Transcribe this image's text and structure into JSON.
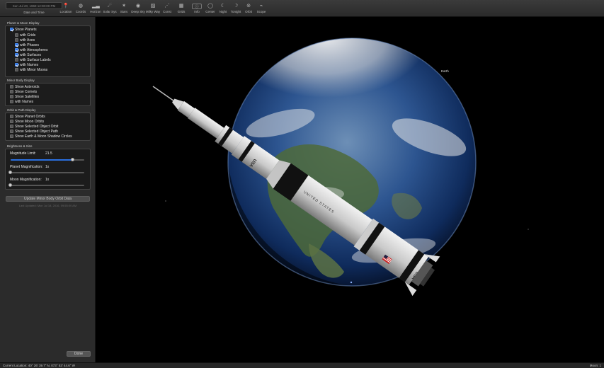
{
  "toolbar": {
    "datetime_value": "Sun Jul 20, 1969   12:00:00 PM",
    "datetime_label": "Date and Time",
    "tools": [
      {
        "label": "Location",
        "icon": "pin-icon"
      },
      {
        "label": "Coords",
        "icon": "globe-icon"
      },
      {
        "label": "Horizon",
        "icon": "horizon-icon"
      },
      {
        "label": "Solar Sys",
        "icon": "solar-system-icon"
      },
      {
        "label": "Stars",
        "icon": "stars-icon"
      },
      {
        "label": "Deep Sky",
        "icon": "galaxy-icon"
      },
      {
        "label": "Milky Way",
        "icon": "milky-way-icon"
      },
      {
        "label": "Const",
        "icon": "constellation-icon"
      },
      {
        "label": "Grids",
        "icon": "grid-icon"
      },
      {
        "label": "Info",
        "icon": "info-icon"
      },
      {
        "label": "Center",
        "icon": "center-icon"
      },
      {
        "label": "Night",
        "icon": "moon-icon"
      },
      {
        "label": "Tonight",
        "icon": "tonight-icon"
      },
      {
        "label": "Orbit",
        "icon": "orbit-icon"
      },
      {
        "label": "Scope",
        "icon": "telescope-icon"
      }
    ]
  },
  "sidebar": {
    "planet_moon": {
      "title": "Planet & Moon Display",
      "items": [
        {
          "label": "Show Planets",
          "checked": true
        },
        {
          "label": "with Grids",
          "checked": false
        },
        {
          "label": "with Axes",
          "checked": false
        },
        {
          "label": "with Phases",
          "checked": true
        },
        {
          "label": "with Atmospheres",
          "checked": true
        },
        {
          "label": "with Surfaces",
          "checked": true
        },
        {
          "label": "with Surface Labels",
          "checked": false
        },
        {
          "label": "with Names",
          "checked": true
        },
        {
          "label": "with Minor Moons",
          "checked": false
        }
      ]
    },
    "minor_body": {
      "title": "Minor Body Display",
      "items": [
        {
          "label": "Show Asteroids",
          "checked": false
        },
        {
          "label": "Show Comets",
          "checked": false
        },
        {
          "label": "Show Satellites",
          "checked": false
        },
        {
          "label": "with Names",
          "checked": false
        }
      ]
    },
    "orbit_path": {
      "title": "Orbit & Path Display",
      "items": [
        {
          "label": "Show Planet Orbits",
          "checked": false
        },
        {
          "label": "Show Moon Orbits",
          "checked": false
        },
        {
          "label": "Show Selected Object Orbit",
          "checked": false
        },
        {
          "label": "Show Selected Object Path",
          "checked": false
        },
        {
          "label": "Show Earth & Moon Shadow Circles",
          "checked": false
        }
      ]
    },
    "brightness": {
      "title": "Brightness & Size",
      "magnitude_label": "Magnitude Limit:",
      "magnitude_value": "21.5",
      "magnitude_level": 0.85,
      "planet_mag_label": "Planet Magnification:",
      "planet_mag_value": "1x",
      "planet_mag_level": 0.0,
      "moon_mag_label": "Moon Magnification:",
      "moon_mag_value": "1x",
      "moon_mag_level": 0.0
    },
    "update_button": "Update Minor Body Orbit Data",
    "last_updated": "Last Updated: Mon Jul 18, 2016, 09:55:00 AM",
    "done_button": "Done"
  },
  "viewport": {
    "earth_label": "Earth",
    "rocket_text_1": "USA",
    "rocket_text_2": "UNITED STATES",
    "rocket_text_3": "USA"
  },
  "statusbar": {
    "location": "Current Location: 40° 26' 39.7\" N, 073° 53' 44.6\" W",
    "right": "Moon: 1"
  },
  "colors": {
    "accent": "#2a6fe0",
    "panel_bg": "#1c1c1c",
    "sidebar_bg": "#2b2b2b"
  }
}
